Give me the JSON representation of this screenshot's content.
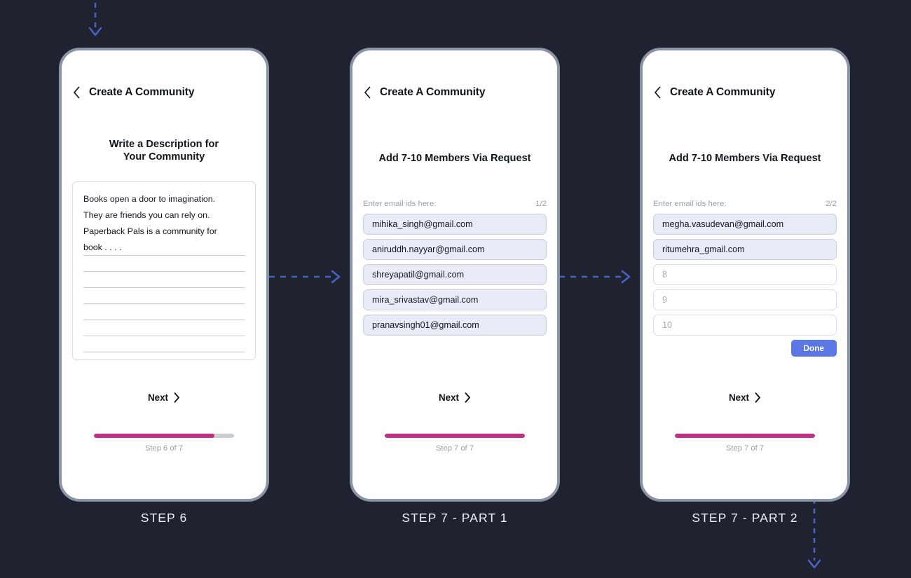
{
  "theme": {
    "background": "#1f2330",
    "phone_frame": "#8b94a6",
    "progress_accent": "#c42e86",
    "progress_track": "#c9cdd4",
    "done_button": "#5b77e6",
    "field_filled": "#e9ecf8",
    "connector": "#4a63c8"
  },
  "icons": {
    "back": "back-chevron-icon",
    "next": "next-chevron-icon",
    "arrow_down": "arrow-down-icon",
    "arrow_right": "arrow-right-icon"
  },
  "screens": [
    {
      "caption": "STEP 6",
      "nav_title": "Create A Community",
      "heading": "Write a Description for Your Community",
      "heading_line1": "Write a Description for",
      "heading_line2": "Your Community",
      "description_lines": [
        "Books open a door to imagination.",
        "They are friends you can rely on.",
        "Paperback Pals is a community for",
        "book . . . ."
      ],
      "next_label": "Next",
      "progress_label": "Step 6 of 7",
      "progress_percent": 86
    },
    {
      "caption": "STEP 7 - PART 1",
      "nav_title": "Create A Community",
      "heading": "Add 7-10 Members Via Request",
      "email_label": "Enter email ids here:",
      "page_count": "1/2",
      "emails": [
        {
          "value": "mihika_singh@gmail.com",
          "filled": true
        },
        {
          "value": "aniruddh.nayyar@gmail.com",
          "filled": true
        },
        {
          "value": "shreyapatil@gmail.com",
          "filled": true
        },
        {
          "value": "mira_srivastav@gmail.com",
          "filled": true
        },
        {
          "value": "pranavsingh01@gmail.com",
          "filled": true
        }
      ],
      "next_label": "Next",
      "progress_label": "Step 7 of 7",
      "progress_percent": 100
    },
    {
      "caption": "STEP 7 - PART 2",
      "nav_title": "Create A Community",
      "heading": "Add 7-10 Members Via Request",
      "email_label": "Enter email ids here:",
      "page_count": "2/2",
      "emails": [
        {
          "value": "megha.vasudevan@gmail.com",
          "filled": true
        },
        {
          "value": "ritumehra_gmail.com",
          "filled": true
        },
        {
          "value": "8",
          "filled": false
        },
        {
          "value": "9",
          "filled": false
        },
        {
          "value": "10",
          "filled": false
        }
      ],
      "done_label": "Done",
      "next_label": "Next",
      "progress_label": "Step 7 of 7",
      "progress_percent": 100
    }
  ]
}
